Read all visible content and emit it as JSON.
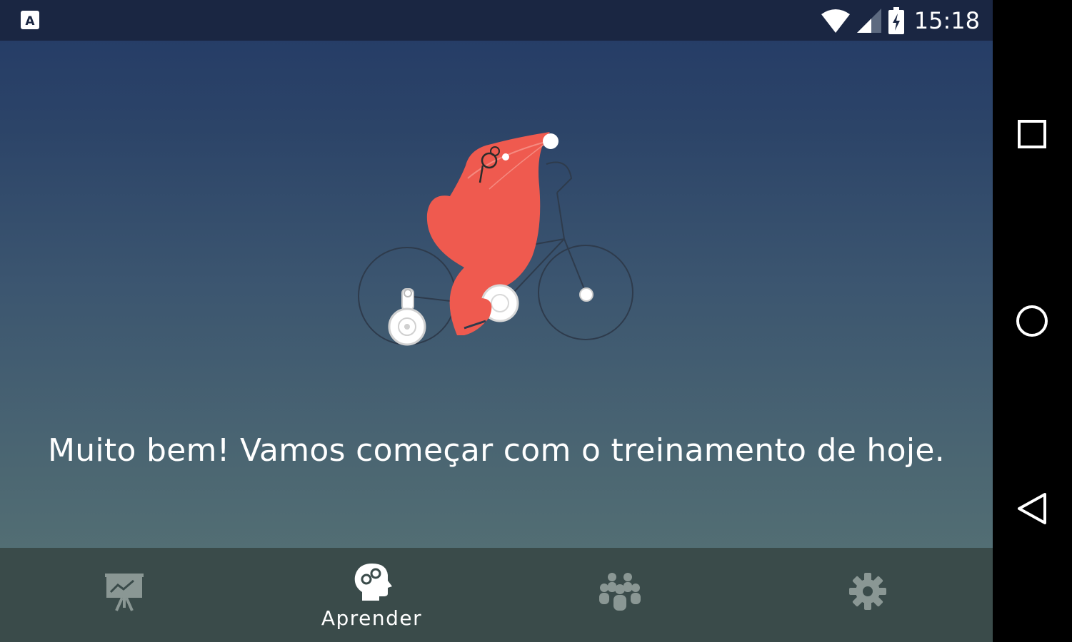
{
  "status_bar": {
    "time": "15:18",
    "icons": [
      "keyboard-a-icon",
      "wifi-icon",
      "cell-signal-icon",
      "battery-charging-icon"
    ]
  },
  "main": {
    "message": "Muito bem! Vamos começar com o treinamento de hoje.",
    "illustration": "squirrel-on-bicycle"
  },
  "bottom_nav": {
    "items": [
      {
        "icon": "progress-chart-icon",
        "label": ""
      },
      {
        "icon": "brain-gears-icon",
        "label": "Aprender",
        "active": true
      },
      {
        "icon": "community-group-icon",
        "label": ""
      },
      {
        "icon": "settings-gear-icon",
        "label": ""
      }
    ]
  },
  "system_nav": {
    "icons": [
      "recents-square-icon",
      "home-circle-icon",
      "back-triangle-icon"
    ]
  },
  "colors": {
    "status_bar": "#1a2642",
    "gradient_top": "#233a66",
    "gradient_bottom": "#5a7675",
    "bottom_nav": "#3a4b4a",
    "mascot": "#ef5a4f",
    "inactive_icon": "#8a9794"
  }
}
